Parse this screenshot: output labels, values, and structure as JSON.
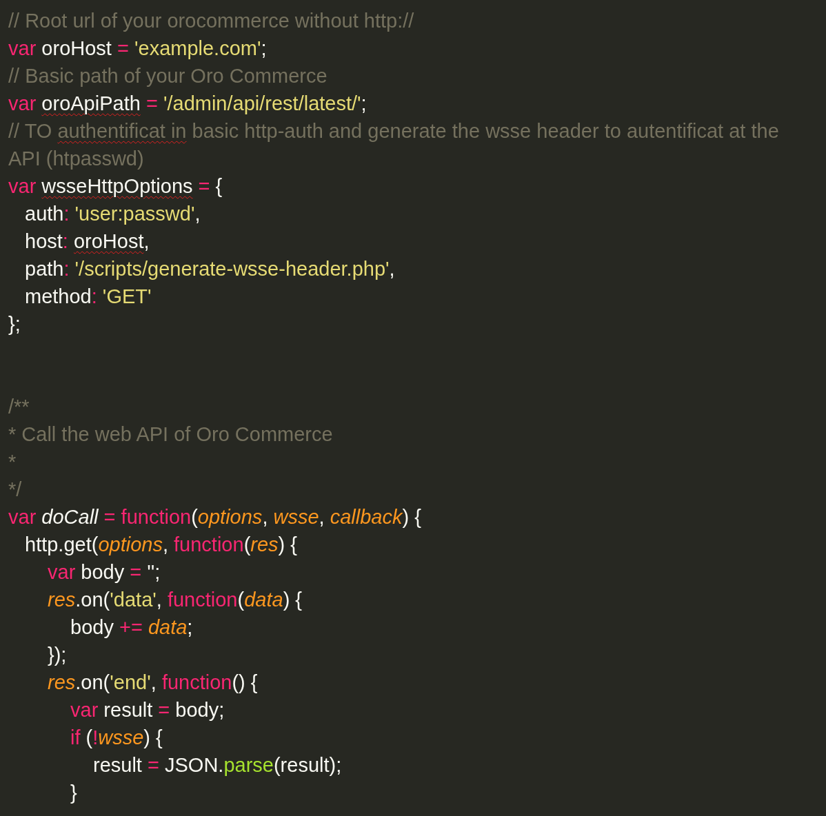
{
  "editor": {
    "lines": [
      {
        "kind": "code",
        "tokens": [
          {
            "text": "// Root url of your orocommerce without http://",
            "kind": "comment"
          }
        ]
      },
      {
        "kind": "code",
        "tokens": [
          {
            "text": "var",
            "kind": "keyword"
          },
          {
            "text": " oroHost ",
            "kind": "plain"
          },
          {
            "text": "= ",
            "kind": "operator"
          },
          {
            "text": "'example.com'",
            "kind": "string"
          },
          {
            "text": ";",
            "kind": "plain"
          }
        ]
      },
      {
        "kind": "code",
        "tokens": [
          {
            "text": "// Basic path of your Oro Commerce",
            "kind": "comment"
          }
        ]
      },
      {
        "kind": "code",
        "tokens": [
          {
            "text": "var ",
            "kind": "keyword"
          },
          {
            "text": "oroApiPath",
            "kind": "plain",
            "misspelled": true
          },
          {
            "text": " = ",
            "kind": "operator"
          },
          {
            "text": "'/admin/api/rest/latest/'",
            "kind": "string"
          },
          {
            "text": ";",
            "kind": "plain"
          }
        ]
      },
      {
        "kind": "code",
        "tokens": [
          {
            "text": "// TO ",
            "kind": "comment"
          },
          {
            "text": "authentificat in",
            "kind": "comment",
            "misspelled": true
          },
          {
            "text": " basic http-auth and generate the wsse header to autentificat at the API (htpasswd)",
            "kind": "comment"
          }
        ]
      },
      {
        "kind": "code",
        "tokens": [
          {
            "text": "var ",
            "kind": "keyword"
          },
          {
            "text": "wsseHttpOptions",
            "kind": "plain",
            "misspelled": true
          },
          {
            "text": " = ",
            "kind": "operator"
          },
          {
            "text": "{",
            "kind": "plain"
          }
        ],
        "children": [
          {
            "kind": "code",
            "tokens": [
              {
                "text": "auth",
                "kind": "plain"
              },
              {
                "text": ": ",
                "kind": "operator"
              },
              {
                "text": "'user:passwd'",
                "kind": "string"
              },
              {
                "text": ",",
                "kind": "plain"
              }
            ]
          },
          {
            "kind": "code",
            "tokens": [
              {
                "text": "host",
                "kind": "plain"
              },
              {
                "text": ": ",
                "kind": "operator"
              },
              {
                "text": "oroHost",
                "kind": "plain",
                "misspelled": true
              },
              {
                "text": ",",
                "kind": "plain"
              }
            ]
          },
          {
            "kind": "code",
            "tokens": [
              {
                "text": "path",
                "kind": "plain"
              },
              {
                "text": ": ",
                "kind": "operator"
              },
              {
                "text": "'/scripts/generate-wsse-header.php'",
                "kind": "string"
              },
              {
                "text": ",",
                "kind": "plain"
              }
            ]
          },
          {
            "kind": "code",
            "tokens": [
              {
                "text": "method",
                "kind": "plain"
              },
              {
                "text": ": ",
                "kind": "operator"
              },
              {
                "text": "'GET'",
                "kind": "string"
              }
            ]
          }
        ]
      },
      {
        "kind": "code",
        "tokens": [
          {
            "text": "};",
            "kind": "plain"
          }
        ]
      },
      {
        "kind": "blank"
      },
      {
        "kind": "blank"
      },
      {
        "kind": "code",
        "tokens": [
          {
            "text": "/**",
            "kind": "comment"
          }
        ]
      },
      {
        "kind": "code",
        "tokens": [
          {
            "text": "* Call the web API of Oro Commerce",
            "kind": "comment"
          }
        ]
      },
      {
        "kind": "code",
        "tokens": [
          {
            "text": "*",
            "kind": "comment"
          }
        ]
      },
      {
        "kind": "code",
        "tokens": [
          {
            "text": "*/",
            "kind": "comment"
          }
        ]
      },
      {
        "kind": "code",
        "tokens": [
          {
            "text": "var ",
            "kind": "keyword"
          },
          {
            "text": "doCall",
            "kind": "name"
          },
          {
            "text": " = function",
            "kind": "keyword"
          },
          {
            "text": "(",
            "kind": "plain"
          },
          {
            "text": "options",
            "kind": "param"
          },
          {
            "text": ", ",
            "kind": "plain"
          },
          {
            "text": "wsse",
            "kind": "param"
          },
          {
            "text": ", ",
            "kind": "plain"
          },
          {
            "text": "callback",
            "kind": "param"
          },
          {
            "text": ") {",
            "kind": "plain"
          }
        ],
        "children": [
          {
            "kind": "code",
            "tokens": [
              {
                "text": "http.get(",
                "kind": "plain"
              },
              {
                "text": "options",
                "kind": "param"
              },
              {
                "text": ", ",
                "kind": "plain"
              },
              {
                "text": "function",
                "kind": "keyword"
              },
              {
                "text": "(",
                "kind": "plain"
              },
              {
                "text": "res",
                "kind": "param"
              },
              {
                "text": ") {",
                "kind": "plain"
              }
            ],
            "children": [
              {
                "kind": "code",
                "tokens": [
                  {
                    "text": "var",
                    "kind": "keyword"
                  },
                  {
                    "text": " body ",
                    "kind": "plain"
                  },
                  {
                    "text": "=",
                    "kind": "operator"
                  },
                  {
                    "text": " '';",
                    "kind": "plain"
                  }
                ]
              },
              {
                "kind": "code",
                "tokens": [
                  {
                    "text": "res",
                    "kind": "param"
                  },
                  {
                    "text": ".on(",
                    "kind": "plain"
                  },
                  {
                    "text": "'data'",
                    "kind": "string"
                  },
                  {
                    "text": ", ",
                    "kind": "plain"
                  },
                  {
                    "text": "function",
                    "kind": "keyword"
                  },
                  {
                    "text": "(",
                    "kind": "plain"
                  },
                  {
                    "text": "data",
                    "kind": "param"
                  },
                  {
                    "text": ") {",
                    "kind": "plain"
                  }
                ],
                "children": [
                  {
                    "kind": "code",
                    "tokens": [
                      {
                        "text": "body ",
                        "kind": "plain"
                      },
                      {
                        "text": "+= ",
                        "kind": "operator"
                      },
                      {
                        "text": "data",
                        "kind": "param"
                      },
                      {
                        "text": ";",
                        "kind": "plain"
                      }
                    ]
                  }
                ]
              },
              {
                "kind": "code",
                "tokens": [
                  {
                    "text": "});",
                    "kind": "plain"
                  }
                ]
              },
              {
                "kind": "code",
                "tokens": [
                  {
                    "text": "res",
                    "kind": "param"
                  },
                  {
                    "text": ".on(",
                    "kind": "plain"
                  },
                  {
                    "text": "'end'",
                    "kind": "string"
                  },
                  {
                    "text": ", ",
                    "kind": "plain"
                  },
                  {
                    "text": "function",
                    "kind": "keyword"
                  },
                  {
                    "text": "() {",
                    "kind": "plain"
                  }
                ],
                "children": [
                  {
                    "kind": "code",
                    "tokens": [
                      {
                        "text": "var",
                        "kind": "keyword"
                      },
                      {
                        "text": " result ",
                        "kind": "plain"
                      },
                      {
                        "text": "=",
                        "kind": "operator"
                      },
                      {
                        "text": " body;",
                        "kind": "plain"
                      }
                    ]
                  },
                  {
                    "kind": "code",
                    "tokens": [
                      {
                        "text": "if",
                        "kind": "keyword"
                      },
                      {
                        "text": " (",
                        "kind": "plain"
                      },
                      {
                        "text": "!",
                        "kind": "operator"
                      },
                      {
                        "text": "wsse",
                        "kind": "param"
                      },
                      {
                        "text": ") {",
                        "kind": "plain"
                      }
                    ],
                    "children": [
                      {
                        "kind": "code",
                        "tokens": [
                          {
                            "text": "result ",
                            "kind": "plain"
                          },
                          {
                            "text": "=",
                            "kind": "operator"
                          },
                          {
                            "text": " JSON.",
                            "kind": "plain"
                          },
                          {
                            "text": "parse",
                            "kind": "builtin"
                          },
                          {
                            "text": "(result);",
                            "kind": "plain"
                          }
                        ]
                      }
                    ]
                  },
                  {
                    "kind": "code",
                    "tokens": [
                      {
                        "text": "}",
                        "kind": "plain"
                      }
                    ]
                  }
                ]
              }
            ]
          }
        ]
      }
    ]
  }
}
